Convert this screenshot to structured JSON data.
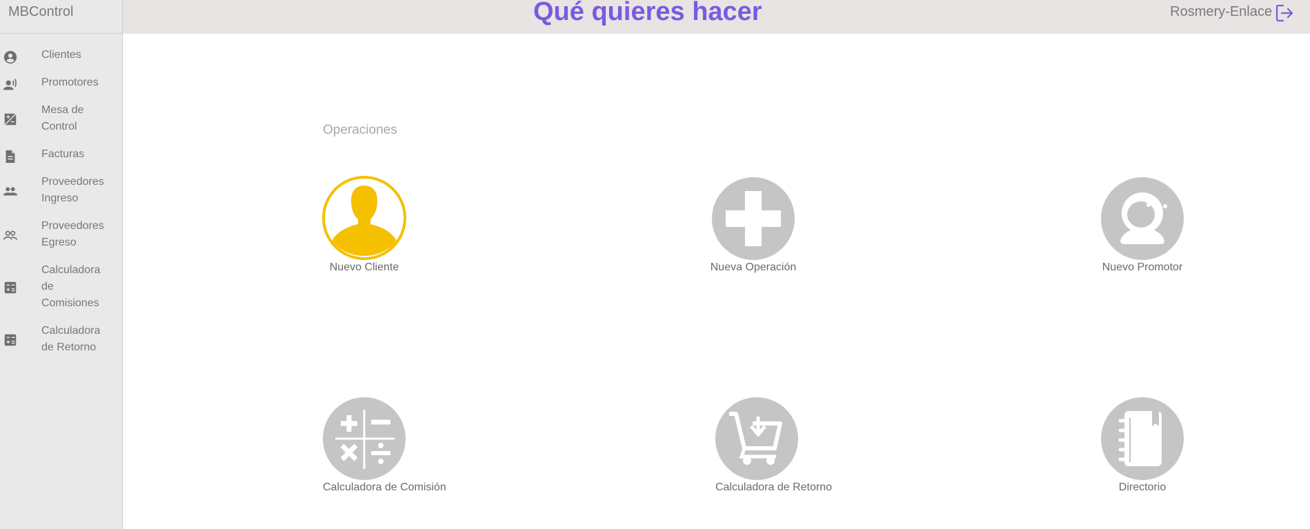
{
  "app": {
    "brand": "MBControl"
  },
  "header": {
    "title": "Qué quieres hacer",
    "user": "Rosmery-Enlace"
  },
  "sidebar": {
    "items": [
      {
        "label": "Clientes",
        "icon": "account-circle-icon"
      },
      {
        "label": "Promotores",
        "icon": "record-voice-icon"
      },
      {
        "label": "Mesa de Control",
        "icon": "exposure-icon"
      },
      {
        "label": "Facturas",
        "icon": "document-icon"
      },
      {
        "label": "Proveedores Ingreso",
        "icon": "people-icon"
      },
      {
        "label": "Proveedores Egreso",
        "icon": "people-outline-icon"
      },
      {
        "label": "Calculadora de Comisiones",
        "icon": "calculator-icon"
      },
      {
        "label": "Calculadora de Retorno",
        "icon": "calculator-icon"
      }
    ]
  },
  "main": {
    "section_label": "Operaciones",
    "operations": [
      {
        "label": "Nuevo Cliente",
        "icon": "person-icon",
        "active": true
      },
      {
        "label": "Nueva Operación",
        "icon": "plus-icon"
      },
      {
        "label": "Nuevo Promotor",
        "icon": "astronaut-icon"
      },
      {
        "label": "Calculadora de Comisión",
        "icon": "math-operations-icon"
      },
      {
        "label": "Calculadora de Retorno",
        "icon": "cart-download-icon"
      },
      {
        "label": "Directorio",
        "icon": "notebook-icon"
      }
    ]
  },
  "colors": {
    "accent": "#7b5ae0",
    "active": "#f5c000",
    "icon_bg": "#c5c5c5"
  }
}
